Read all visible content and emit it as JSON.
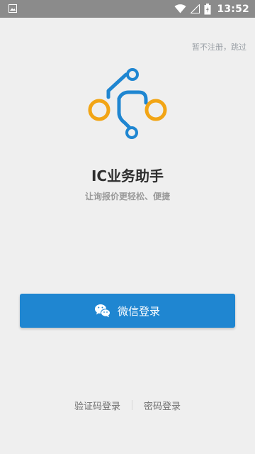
{
  "status_bar": {
    "time": "13:52",
    "icons": [
      "image-icon",
      "wifi-icon",
      "signal-icon",
      "battery-charging-icon"
    ]
  },
  "skip": {
    "label": "暂不注册，跳过"
  },
  "app": {
    "title": "IC业务助手",
    "subtitle": "让询报价更轻松、便捷",
    "logo": "circuit-node-logo"
  },
  "wechat_login": {
    "label": "微信登录",
    "icon": "wechat-icon"
  },
  "alt_logins": {
    "code_login": "验证码登录",
    "password_login": "密码登录"
  },
  "colors": {
    "status_bar_bg": "#8b8b8b",
    "page_bg": "#efefef",
    "brand_blue": "#1f86d1",
    "brand_orange": "#f2a515",
    "title_text": "#2f2f2f",
    "muted_text": "#9a9a9a"
  }
}
